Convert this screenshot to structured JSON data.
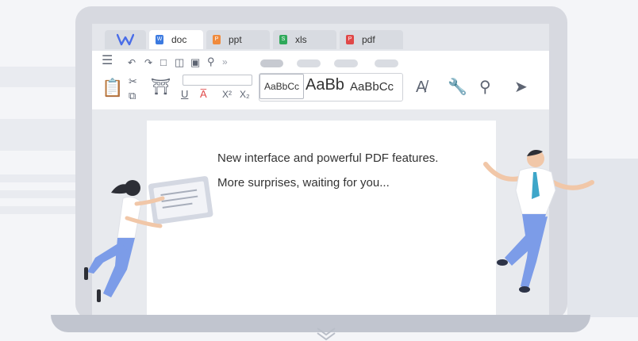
{
  "tabs": [
    {
      "label": "doc",
      "color": "#3b7ae0"
    },
    {
      "label": "ppt",
      "color": "#f08a3c"
    },
    {
      "label": "xls",
      "color": "#2fa95a"
    },
    {
      "label": "pdf",
      "color": "#e04848"
    }
  ],
  "style_gallery": {
    "first": "AaBbCc",
    "second": "AaBb",
    "third": "AaBbCc"
  },
  "document": {
    "line1": "New interface and powerful PDF features.",
    "line2": "More surprises, waiting for you..."
  },
  "colors": {
    "logo": "#4a6de8",
    "person_shirt": "#ffffff",
    "person_pants": "#7c9ce8",
    "person_tie": "#3ea6c9"
  }
}
